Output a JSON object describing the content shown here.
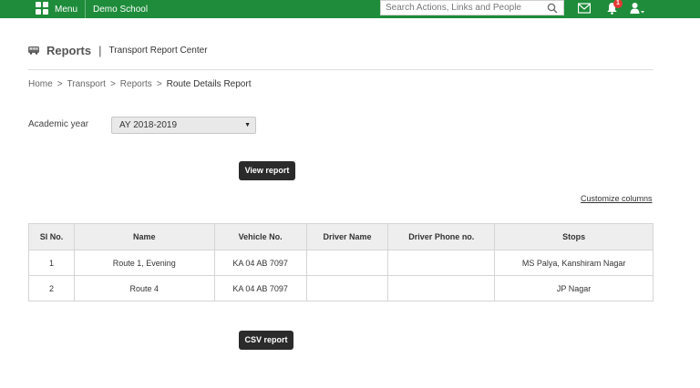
{
  "topbar": {
    "menu_label": "Menu",
    "school_name": "Demo School",
    "search_placeholder": "Search Actions, Links and People",
    "notification_count": "1",
    "icons": [
      "grid-icon",
      "search-icon",
      "mail-icon",
      "bell-icon",
      "user-icon"
    ],
    "bar_color": "#1e8c3a"
  },
  "header": {
    "title": "Reports",
    "separator": "|",
    "subtitle": "Transport Report Center"
  },
  "breadcrumb": {
    "items": [
      "Home",
      "Transport",
      "Reports"
    ],
    "current": "Route Details Report",
    "arrow": ">"
  },
  "filters": {
    "academic_year_label": "Academic year",
    "academic_year_value": "AY 2018-2019"
  },
  "actions": {
    "view_report": "View report",
    "customize_columns": "Customize columns",
    "csv_report": "CSV report"
  },
  "table": {
    "columns": [
      "Sl No.",
      "Name",
      "Vehicle No.",
      "Driver Name",
      "Driver Phone no.",
      "Stops"
    ],
    "rows": [
      [
        "1",
        "Route 1, Evening",
        "KA 04 AB 7097",
        "",
        "",
        "MS Palya, Kanshiram Nagar"
      ],
      [
        "2",
        "Route 4",
        "KA 04 AB 7097",
        "",
        "",
        "JP Nagar"
      ]
    ]
  }
}
